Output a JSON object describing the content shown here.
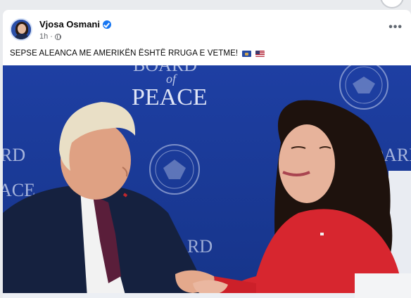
{
  "post": {
    "author": "Vjosa Osmani",
    "time": "1h",
    "separator": "·",
    "text": "SEPSE ALEANCA ME AMERIKËN ËSHTË RRUGA E VETME!",
    "more": "•••"
  },
  "photo": {
    "backdrop_words": [
      "BOARD",
      "of",
      "PEACE",
      "RD",
      "ACE",
      "RD",
      "BOARD"
    ]
  },
  "icons": {
    "verified": "verified-badge-icon",
    "privacy": "globe-icon",
    "flags": [
      "kosovo-flag-icon",
      "usa-flag-icon"
    ]
  },
  "colors": {
    "backdrop_blue": "#1b3a9a",
    "accent_blue": "#1877f2",
    "red_dress": "#d7262f"
  }
}
